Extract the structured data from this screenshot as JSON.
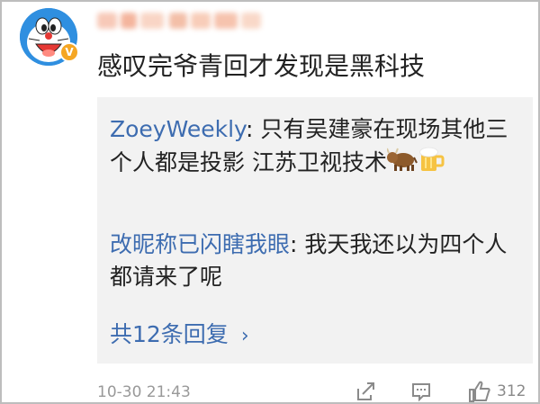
{
  "post": {
    "comment_text": "感叹完爷青回才发现是黑科技",
    "verified_badge": "V",
    "timestamp": "10-30 21:43",
    "like_count": "312"
  },
  "replies": [
    {
      "user": "ZoeyWeekly",
      "separator": ": ",
      "text": "只有吴建豪在现场其他三个人都是投影 江苏卫视技术"
    },
    {
      "user": "改昵称已闪瞎我眼",
      "separator": ": ",
      "text": "我天我还以为四个人都请来了呢"
    }
  ],
  "more_replies": {
    "label": "共12条回复",
    "chevron": "›"
  },
  "icons": [
    "doraemon-avatar",
    "verified-badge-icon",
    "ox-emoji-icon",
    "beer-emoji-icon",
    "share-icon",
    "comment-icon",
    "like-icon"
  ],
  "colors": {
    "link": "#3d6cb0",
    "reply_bg": "#f2f2f2",
    "badge": "#f5a623",
    "muted": "#999999"
  }
}
